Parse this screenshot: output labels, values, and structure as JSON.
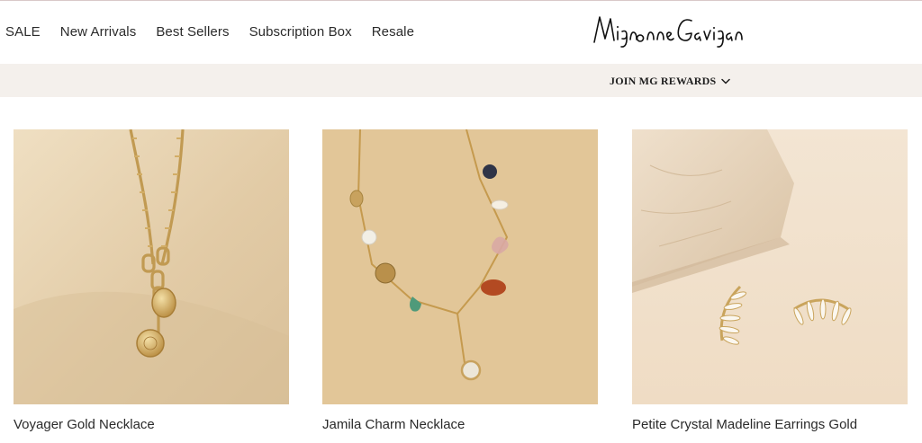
{
  "nav": {
    "links": [
      "SALE",
      "New Arrivals",
      "Best Sellers",
      "Subscription Box",
      "Resale"
    ]
  },
  "logo": {
    "text": "Mignonne Gavigan"
  },
  "rewards": {
    "label": "JOIN MG REWARDS",
    "icon": "chevron-down-icon"
  },
  "products": [
    {
      "name": "Voyager Gold Necklace"
    },
    {
      "name": "Jamila Charm Necklace"
    },
    {
      "name": "Petite Crystal Madeline Earrings Gold"
    }
  ],
  "colors": {
    "rewards_bar": "#f4f0ec",
    "gold": "#c9a45c",
    "card1_bg": "#e6d3b0",
    "card2_bg": "#e5c89a",
    "card3_bg": "#f1e1cd"
  }
}
